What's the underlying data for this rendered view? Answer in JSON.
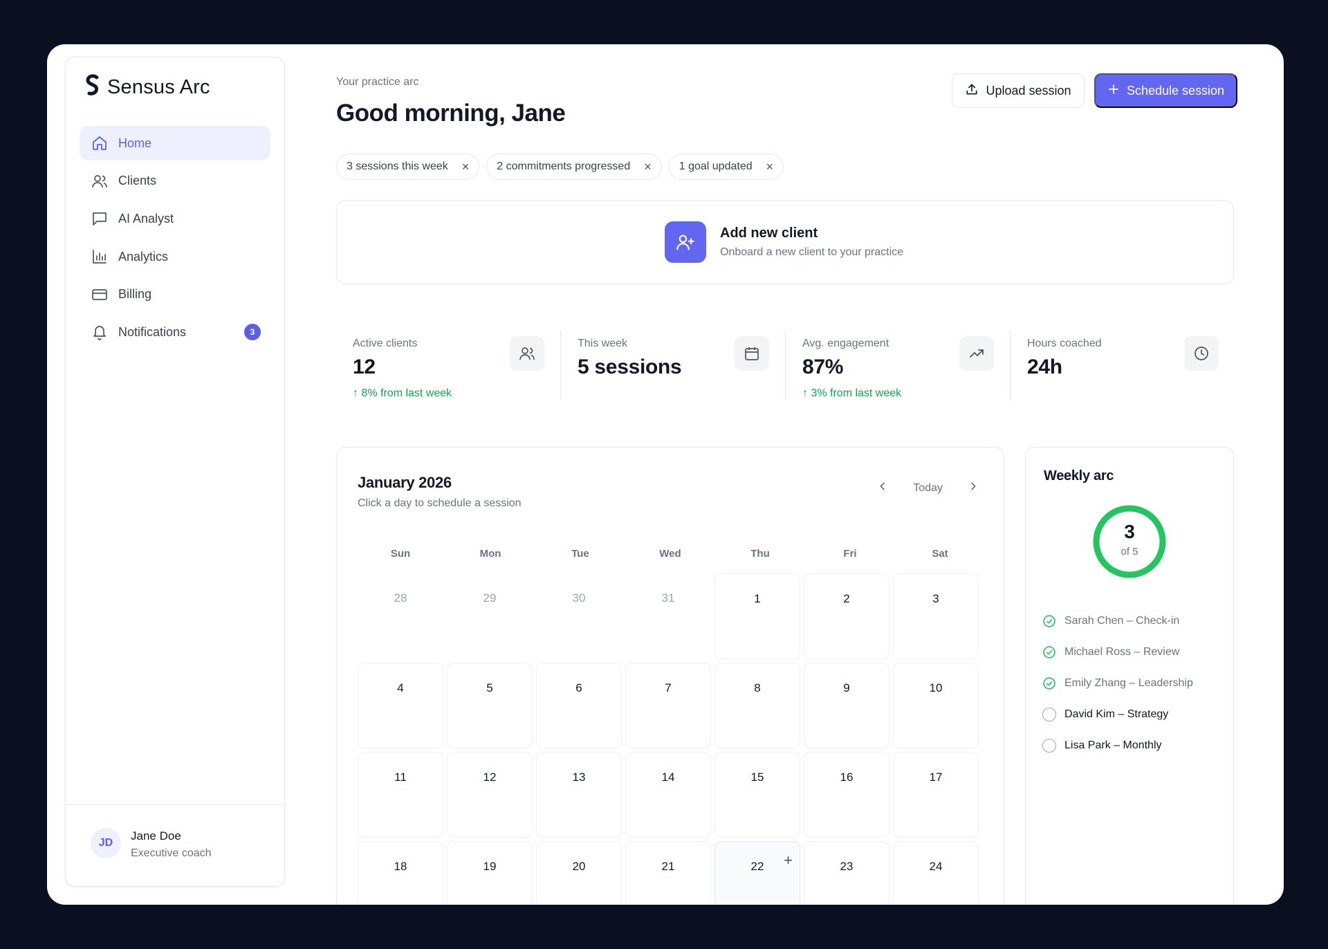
{
  "brand": {
    "name": "Sensus Arc",
    "accent": "#6366f1"
  },
  "sidebar": {
    "items": [
      {
        "label": "Home",
        "icon": "home-icon",
        "active": true
      },
      {
        "label": "Clients",
        "icon": "users-icon"
      },
      {
        "label": "AI Analyst",
        "icon": "message-square-icon"
      },
      {
        "label": "Analytics",
        "icon": "bar-chart-icon"
      },
      {
        "label": "Billing",
        "icon": "credit-card-icon"
      },
      {
        "label": "Notifications",
        "icon": "bell-icon",
        "badge": "3"
      }
    ],
    "user": {
      "initials": "JD",
      "name": "Jane Doe",
      "role": "Executive coach"
    }
  },
  "header": {
    "eyebrow": "Your practice arc",
    "greeting": "Good morning, Jane",
    "upload_label": "Upload session",
    "schedule_label": "Schedule session"
  },
  "chips": [
    {
      "label": "3 sessions this week"
    },
    {
      "label": "2 commitments progressed"
    },
    {
      "label": "1 goal updated"
    }
  ],
  "chip_close": "×",
  "add_client": {
    "title": "Add new client",
    "subtitle": "Onboard a new client to your practice"
  },
  "stats": [
    {
      "label": "Active clients",
      "value": "12",
      "delta": "↑ 8% from last week",
      "icon": "users-icon"
    },
    {
      "label": "This week",
      "value": "5 sessions",
      "delta": "",
      "icon": "calendar-icon"
    },
    {
      "label": "Avg. engagement",
      "value": "87%",
      "delta": "↑ 3% from last week",
      "icon": "trending-up-icon"
    },
    {
      "label": "Hours coached",
      "value": "24h",
      "delta": "",
      "icon": "clock-icon"
    }
  ],
  "calendar": {
    "title": "January 2026",
    "subtitle": "Click a day to schedule a session",
    "today_label": "Today",
    "weekdays": [
      "Sun",
      "Mon",
      "Tue",
      "Wed",
      "Thu",
      "Fri",
      "Sat"
    ],
    "days": [
      {
        "n": "28",
        "muted": true
      },
      {
        "n": "29",
        "muted": true
      },
      {
        "n": "30",
        "muted": true
      },
      {
        "n": "31",
        "muted": true
      },
      {
        "n": "1"
      },
      {
        "n": "2"
      },
      {
        "n": "3"
      },
      {
        "n": "4"
      },
      {
        "n": "5"
      },
      {
        "n": "6"
      },
      {
        "n": "7"
      },
      {
        "n": "8"
      },
      {
        "n": "9"
      },
      {
        "n": "10"
      },
      {
        "n": "11"
      },
      {
        "n": "12"
      },
      {
        "n": "13"
      },
      {
        "n": "14"
      },
      {
        "n": "15"
      },
      {
        "n": "16"
      },
      {
        "n": "17"
      },
      {
        "n": "18"
      },
      {
        "n": "19"
      },
      {
        "n": "20"
      },
      {
        "n": "21"
      },
      {
        "n": "22",
        "hover": true
      },
      {
        "n": "23"
      },
      {
        "n": "24"
      }
    ],
    "add_glyph": "+"
  },
  "weekly": {
    "title": "Weekly arc",
    "done": "3",
    "total_label": "of 5",
    "progress": 1.0,
    "ring_color": "#22c55e",
    "items": [
      {
        "label": "Sarah Chen – Check-in",
        "done": true
      },
      {
        "label": "Michael Ross – Review",
        "done": true
      },
      {
        "label": "Emily Zhang – Leadership",
        "done": true
      },
      {
        "label": "David Kim – Strategy",
        "done": false
      },
      {
        "label": "Lisa Park – Monthly",
        "done": false
      }
    ]
  }
}
